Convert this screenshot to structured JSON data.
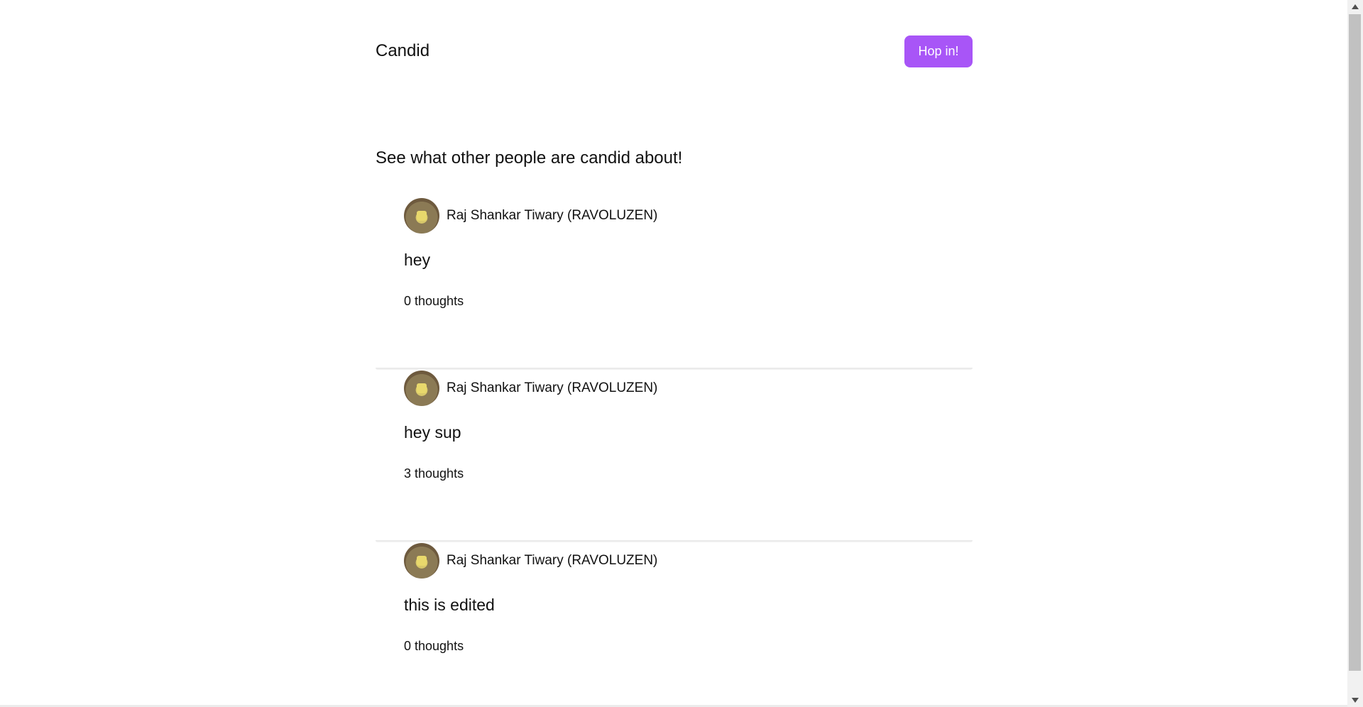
{
  "nav": {
    "brand": "Candid",
    "cta_label": "Hop in!",
    "cta_color": "#a855f7"
  },
  "feed": {
    "tagline": "See what other people are candid about!",
    "posts": [
      {
        "author": "Raj Shankar Tiwary (RAVOLUZEN)",
        "text": "hey",
        "thoughts": "0 thoughts"
      },
      {
        "author": "Raj Shankar Tiwary (RAVOLUZEN)",
        "text": "hey sup",
        "thoughts": "3 thoughts"
      },
      {
        "author": "Raj Shankar Tiwary (RAVOLUZEN)",
        "text": "this is edited",
        "thoughts": "0 thoughts"
      }
    ]
  },
  "icons": {
    "avatar": "user-avatar-icon",
    "scroll_up": "chevron-up-icon",
    "scroll_down": "chevron-down-icon"
  }
}
